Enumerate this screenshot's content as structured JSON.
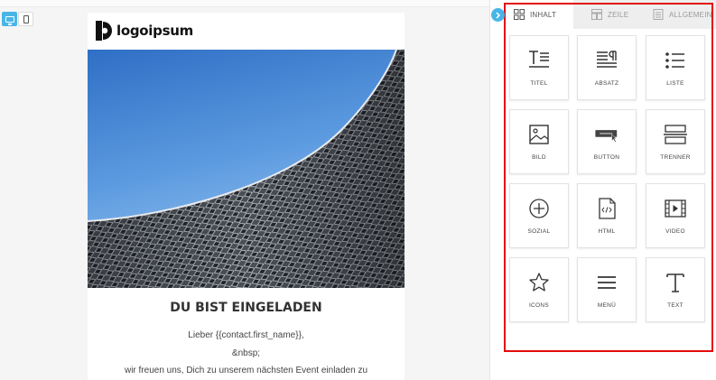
{
  "preview": {
    "device_desktop": "desktop-view",
    "device_mobile": "mobile-view"
  },
  "email": {
    "logo_text": "logoipsum",
    "headline": "DU BIST EINGELADEN",
    "greeting": "Lieber {{contact.first_name}},",
    "nbsp": "&nbsp;",
    "intro": "wir freuen uns, Dich zu unserem nächsten Event einladen zu"
  },
  "sidebar": {
    "tabs": [
      {
        "label": "INHALT",
        "icon": "grid-icon",
        "active": true
      },
      {
        "label": "ZEILE",
        "icon": "rows-icon",
        "active": false
      },
      {
        "label": "ALLGEMEIN",
        "icon": "document-icon",
        "active": false
      }
    ],
    "blocks": [
      {
        "label": "TITEL",
        "icon": "title-icon"
      },
      {
        "label": "ABSATZ",
        "icon": "paragraph-icon"
      },
      {
        "label": "LISTE",
        "icon": "list-icon"
      },
      {
        "label": "BILD",
        "icon": "image-icon"
      },
      {
        "label": "BUTTON",
        "icon": "button-icon"
      },
      {
        "label": "TRENNER",
        "icon": "divider-icon"
      },
      {
        "label": "SOZIAL",
        "icon": "social-icon"
      },
      {
        "label": "HTML",
        "icon": "html-icon"
      },
      {
        "label": "VIDEO",
        "icon": "video-icon"
      },
      {
        "label": "ICONS",
        "icon": "star-icon"
      },
      {
        "label": "MENÜ",
        "icon": "menu-icon"
      },
      {
        "label": "TEXT",
        "icon": "text-icon"
      }
    ]
  },
  "colors": {
    "accent": "#49b5e7",
    "highlight": "#e30b0b",
    "sky": "#3f86d6"
  }
}
